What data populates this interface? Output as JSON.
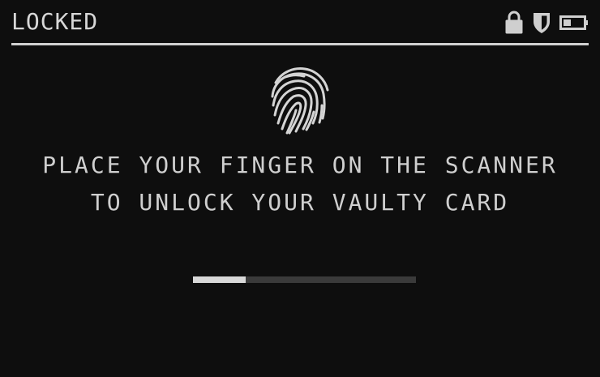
{
  "status_bar": {
    "title": "LOCKED",
    "icons": [
      "lock-icon",
      "shield-icon",
      "battery-icon"
    ]
  },
  "main": {
    "icon": "fingerprint-icon",
    "message_line_1": "PLACE YOUR FINGER ON THE SCANNER",
    "message_line_2": "TO UNLOCK YOUR VAULTY CARD"
  },
  "progress": {
    "value": 0.235
  },
  "colors": {
    "background": "#0e0e0e",
    "foreground": "#cfcfcf",
    "track": "#3a3a3a"
  }
}
